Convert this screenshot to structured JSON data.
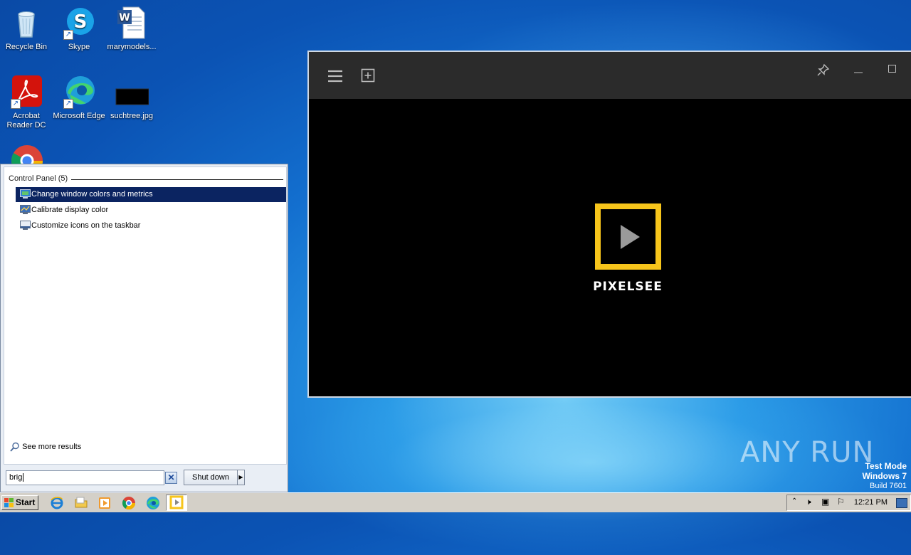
{
  "desktop": {
    "icons": [
      {
        "label": "Recycle Bin",
        "icon": "recycle-bin-icon"
      },
      {
        "label": "Skype",
        "icon": "skype-icon"
      },
      {
        "label": "marymodels...",
        "icon": "word-document-icon"
      },
      {
        "label": "Acrobat Reader DC",
        "icon": "acrobat-reader-icon"
      },
      {
        "label": "Microsoft Edge",
        "icon": "edge-icon"
      },
      {
        "label": "suchtree.jpg",
        "icon": "image-file-icon"
      }
    ]
  },
  "pixelsee": {
    "brand": "PIXELSEE",
    "accent": "#f7c51b"
  },
  "start_menu": {
    "section_header": "Control Panel (5)",
    "results": [
      {
        "label": "Change window colors and metrics",
        "icon": "display-color-icon",
        "selected": true
      },
      {
        "label": "Calibrate display color",
        "icon": "calibrate-icon",
        "selected": false
      },
      {
        "label": "Customize icons on the taskbar",
        "icon": "taskbar-icon",
        "selected": false
      }
    ],
    "see_more": "See more results",
    "search_value": "brig",
    "shutdown_label": "Shut down"
  },
  "taskbar": {
    "start_label": "Start",
    "clock": "12:21 PM",
    "pinned": [
      "internet-explorer-icon",
      "explorer-folder-icon",
      "media-player-icon",
      "chrome-icon",
      "edge-icon",
      "pixelsee-icon"
    ]
  },
  "watermark": {
    "anyrun": "ANY RUN",
    "test_mode": "Test Mode",
    "os": "Windows 7",
    "build": "Build 7601"
  }
}
